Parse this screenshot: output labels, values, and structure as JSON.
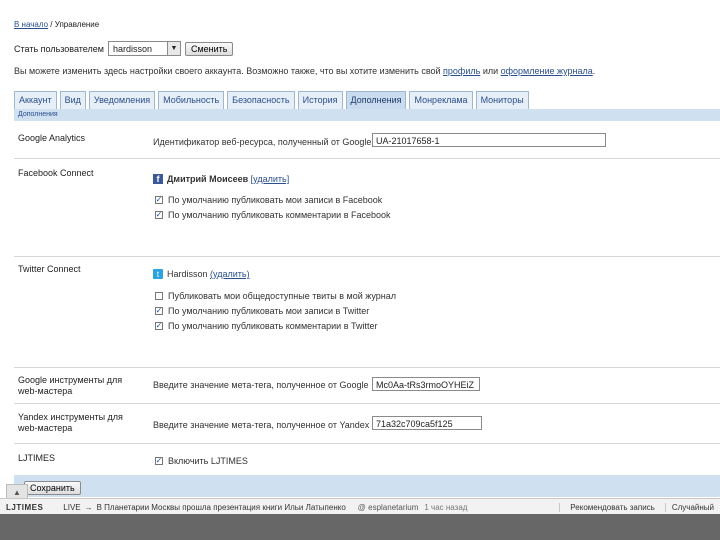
{
  "breadcrumb": {
    "home": "В начало",
    "separator": " / ",
    "current": "Управление"
  },
  "user_switch": {
    "label": "Стать пользователем",
    "value": "hardisson",
    "button": "Сменить"
  },
  "intro": {
    "before": "Вы можете изменить здесь настройки своего аккаунта. Возможно также, что вы хотите изменить свой ",
    "link1": "профиль",
    "middle": " или ",
    "link2": "оформление журнала",
    "after": "."
  },
  "tabs": [
    {
      "label": "Аккаунт"
    },
    {
      "label": "Вид"
    },
    {
      "label": "Уведомления"
    },
    {
      "label": "Мобильность"
    },
    {
      "label": "Безопасность"
    },
    {
      "label": "История"
    },
    {
      "label": "Дополнения"
    },
    {
      "label": "Монреклама"
    },
    {
      "label": "Мониторы"
    }
  ],
  "active_tab_strip": "Дополнения",
  "google_analytics": {
    "title": "Google Analytics",
    "label": "Идентификатор веб-ресурса, полученный от Google",
    "value": "UA-21017658-1"
  },
  "facebook": {
    "title": "Facebook Connect",
    "name": "Дмитрий Моисеев",
    "remove": "[удалить]",
    "opt1": "По умолчанию публиковать мои записи в Facebook",
    "opt2": "По умолчанию публиковать комментарии в Facebook"
  },
  "twitter": {
    "title": "Twitter Connect",
    "name": "Hardisson",
    "remove": "(удалить)",
    "opt1": "Публиковать мои общедоступные твиты в мой журнал",
    "opt2": "По умолчанию публиковать мои записи в Twitter",
    "opt3": "По умолчанию публиковать комментарии в Twitter"
  },
  "google_webmaster": {
    "title": "Google инструменты для web-мастера",
    "label": "Введите значение мета-тега, полученное от Google",
    "value": "Mc0Aa-tRs3rmoOYHEiZ"
  },
  "yandex_webmaster": {
    "title": "Yandex инструменты для web-мастера",
    "label": "Введите значение мета-тега, полученное от Yandex",
    "value": "71a32c709ca5f125"
  },
  "ljtimes": {
    "title": "LJTIMES",
    "opt": "Включить LJTIMES"
  },
  "save_button": "Сохранить",
  "bottombar": {
    "logo": "LJTIMES",
    "live": "LIVE",
    "arrow": "→",
    "news": "В Планетарии Москвы прошла презентация книги Ильи Латыпенко",
    "source": "@ esplanetarium",
    "time": "1 час назад",
    "recommend": "Рекомендовать запись",
    "random": "Случайный"
  }
}
